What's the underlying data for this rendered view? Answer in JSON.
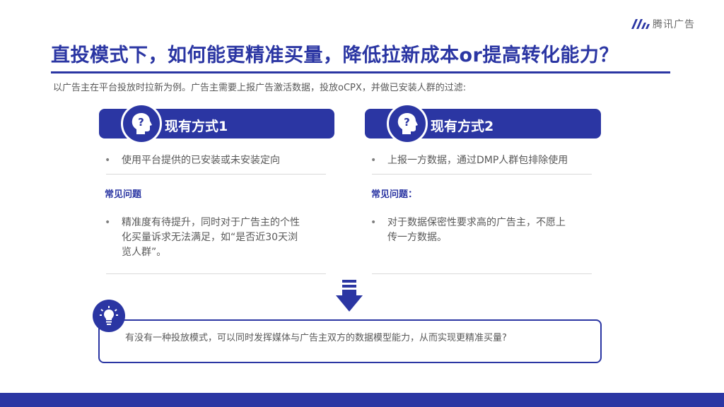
{
  "brand": {
    "logo_text": "腾讯广告",
    "icon": "tencent-ads-logo-icon"
  },
  "title": "直投模式下，如何能更精准买量，降低拉新成本or提高转化能力？",
  "subtitle": "以广告主在平台投放时拉新为例。广告主需要上报广告激活数据，投放oCPX，并做已安装人群的过滤:",
  "methods": [
    {
      "header": "现有方式1",
      "icon": "head-question-icon",
      "bullet": "使用平台提供的已安装或未安装定向",
      "problems_label": "常见问题",
      "problems": [
        "精准度有待提升，同时对于广告主的个性",
        "化买量诉求无法满足，如“是否近30天浏",
        "览人群”。"
      ]
    },
    {
      "header": "现有方式2",
      "icon": "head-question-icon",
      "bullet": "上报一方数据，通过DMP人群包排除使用",
      "problems_label": "常见问题：",
      "problems": [
        "对于数据保密性要求高的广告主，不愿上",
        "传一方数据。"
      ]
    }
  ],
  "arrow_icon": "down-arrow-icon",
  "conclusion": {
    "icon": "lightbulb-icon",
    "text": "有没有一种投放模式，可以同时发挥媒体与广告主双方的数据模型能力，从而实现更精准买量?"
  },
  "colors": {
    "accent": "#2b36a3",
    "text": "#595959",
    "separator": "#d9d9d9"
  }
}
